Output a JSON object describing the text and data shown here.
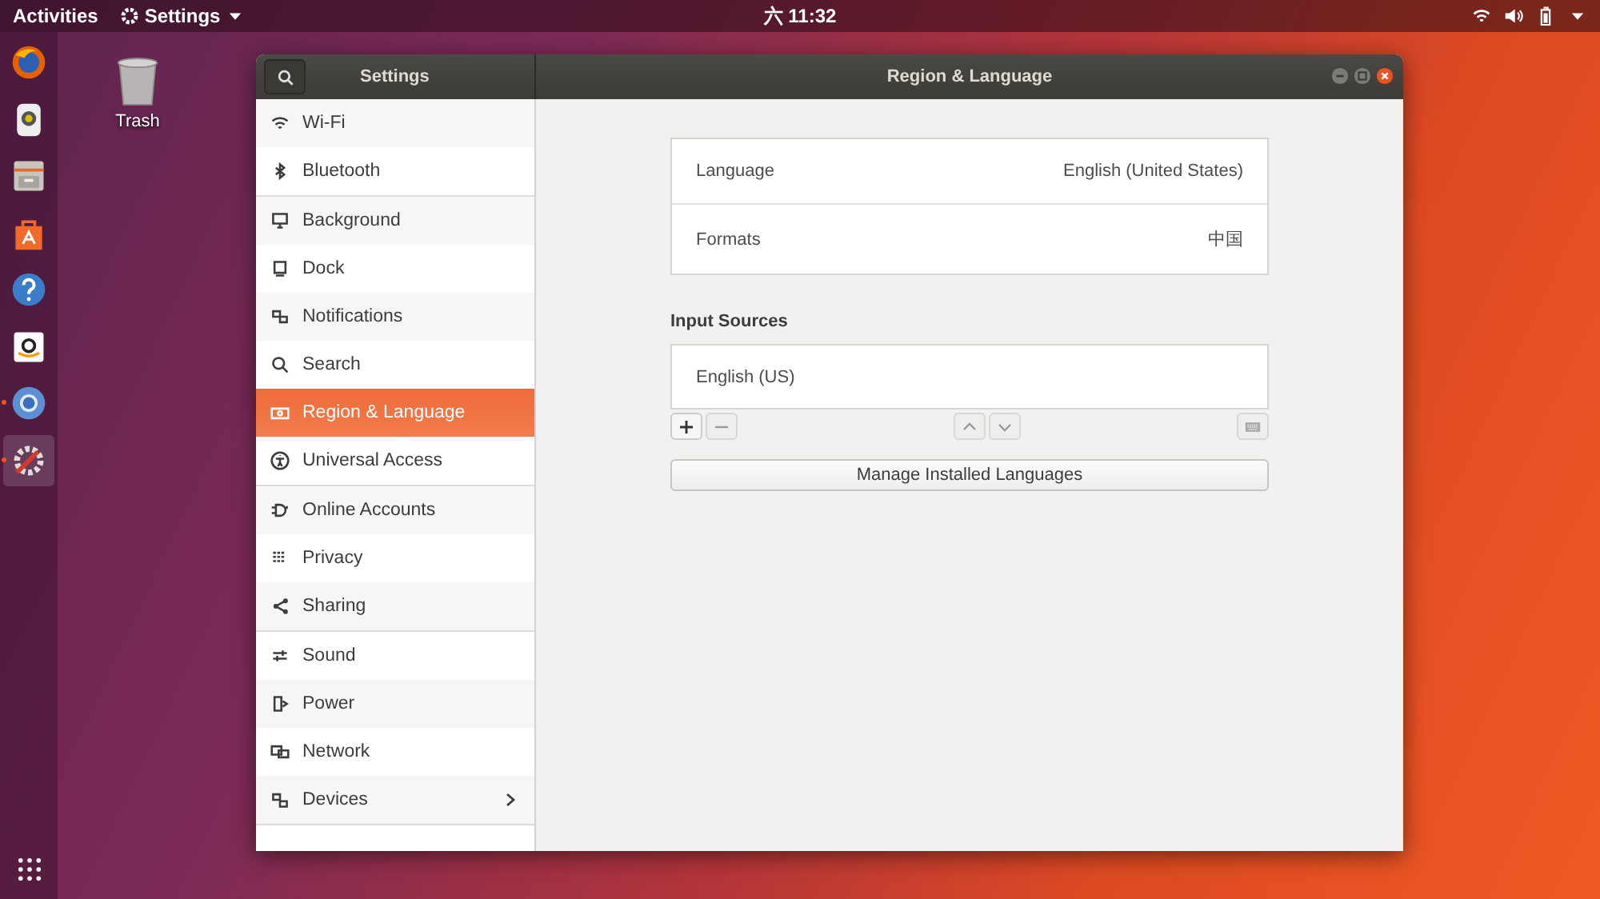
{
  "top_bar": {
    "activities": "Activities",
    "app_menu": "Settings",
    "clock": "六 11:32"
  },
  "dock": {
    "items": [
      {
        "selected": false,
        "running": false
      },
      {
        "selected": false,
        "running": false
      },
      {
        "selected": false,
        "running": false
      },
      {
        "selected": false,
        "running": false
      },
      {
        "selected": false,
        "running": false
      },
      {
        "selected": false,
        "running": false
      },
      {
        "selected": false,
        "running": true
      },
      {
        "selected": true,
        "running": true
      }
    ]
  },
  "desktop": {
    "icons": [
      {
        "label": "Trash"
      }
    ]
  },
  "window": {
    "sidebar_title": "Settings",
    "title": "Region & Language"
  },
  "sidebar": {
    "groups": [
      {
        "items": [
          {
            "label": "Wi-Fi",
            "selected": false,
            "submenu": false
          },
          {
            "label": "Bluetooth",
            "selected": false,
            "submenu": false
          }
        ]
      },
      {
        "items": [
          {
            "label": "Background",
            "selected": false,
            "submenu": false
          },
          {
            "label": "Dock",
            "selected": false,
            "submenu": false
          },
          {
            "label": "Notifications",
            "selected": false,
            "submenu": false
          },
          {
            "label": "Search",
            "selected": false,
            "submenu": false
          },
          {
            "label": "Region & Language",
            "selected": true,
            "submenu": false
          },
          {
            "label": "Universal Access",
            "selected": false,
            "submenu": false
          }
        ]
      },
      {
        "items": [
          {
            "label": "Online Accounts",
            "selected": false,
            "submenu": false
          },
          {
            "label": "Privacy",
            "selected": false,
            "submenu": false
          },
          {
            "label": "Sharing",
            "selected": false,
            "submenu": false
          }
        ]
      },
      {
        "items": [
          {
            "label": "Sound",
            "selected": false,
            "submenu": false
          },
          {
            "label": "Power",
            "selected": false,
            "submenu": false
          },
          {
            "label": "Network",
            "selected": false,
            "submenu": false
          },
          {
            "label": "Devices",
            "selected": false,
            "submenu": true
          }
        ]
      }
    ]
  },
  "language_settings": [
    {
      "label": "Language",
      "value": "English (United States)"
    },
    {
      "label": "Formats",
      "value": "中国"
    }
  ],
  "input_sources": {
    "heading": "Input Sources",
    "sources": [
      {
        "label": "English (US)"
      }
    ]
  },
  "manage_button": "Manage Installed Languages"
}
